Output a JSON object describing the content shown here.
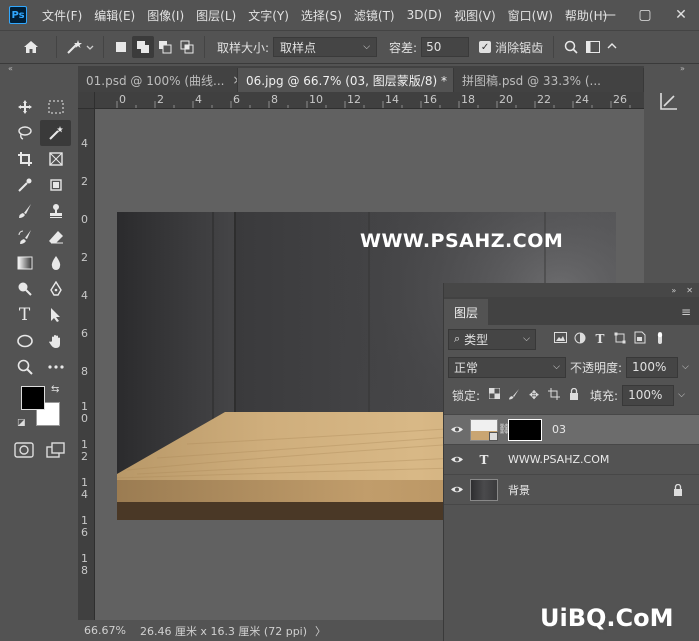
{
  "app": {
    "logo": "Ps"
  },
  "menu": [
    "文件(F)",
    "编辑(E)",
    "图像(I)",
    "图层(L)",
    "文字(Y)",
    "选择(S)",
    "滤镜(T)",
    "3D(D)",
    "视图(V)",
    "窗口(W)",
    "帮助(H)"
  ],
  "window_controls": {
    "minimize": "—",
    "maximize": "▢",
    "close": "✕"
  },
  "options": {
    "sample_size_label": "取样大小:",
    "sample_size_value": "取样点",
    "tolerance_label": "容差:",
    "tolerance_value": "50",
    "antialias_label": "消除锯齿",
    "antialias_checked": true
  },
  "tabs": [
    {
      "label": "01.psd @ 100% (曲线...",
      "close": "×",
      "active": false
    },
    {
      "label": "06.jpg @ 66.7% (03, 图层蒙版/8) *",
      "close": "×",
      "active": true
    },
    {
      "label": "拼图稿.psd @ 33.3% (...",
      "close": "",
      "active": false
    }
  ],
  "ruler_h": [
    "0",
    "2",
    "4",
    "6",
    "8",
    "10",
    "12",
    "14",
    "16",
    "18",
    "20",
    "22",
    "24",
    "26"
  ],
  "ruler_v": [
    "4",
    "2",
    "0",
    "2",
    "4",
    "6",
    "8",
    "1 0",
    "1 2",
    "1 4",
    "1 6",
    "1 8"
  ],
  "canvas": {
    "watermark": "WWW.PSAHZ.COM"
  },
  "status": {
    "zoom": "66.67%",
    "info": "26.46 厘米 x 16.3 厘米 (72 ppi)",
    "arrow": "〉"
  },
  "layers_panel": {
    "tab": "图层",
    "filter_label": "类型",
    "blend_mode": "正常",
    "opacity_label": "不透明度:",
    "opacity_value": "100%",
    "lock_label": "锁定:",
    "fill_label": "填充:",
    "fill_value": "100%",
    "layers": [
      {
        "name": "03",
        "type": "smart-with-mask",
        "selected": true
      },
      {
        "name": "WWW.PSAHZ.COM",
        "type": "text",
        "selected": false
      },
      {
        "name": "背景",
        "type": "background",
        "locked": true,
        "selected": false
      }
    ]
  },
  "footer_watermark": "UiBQ.CoM"
}
